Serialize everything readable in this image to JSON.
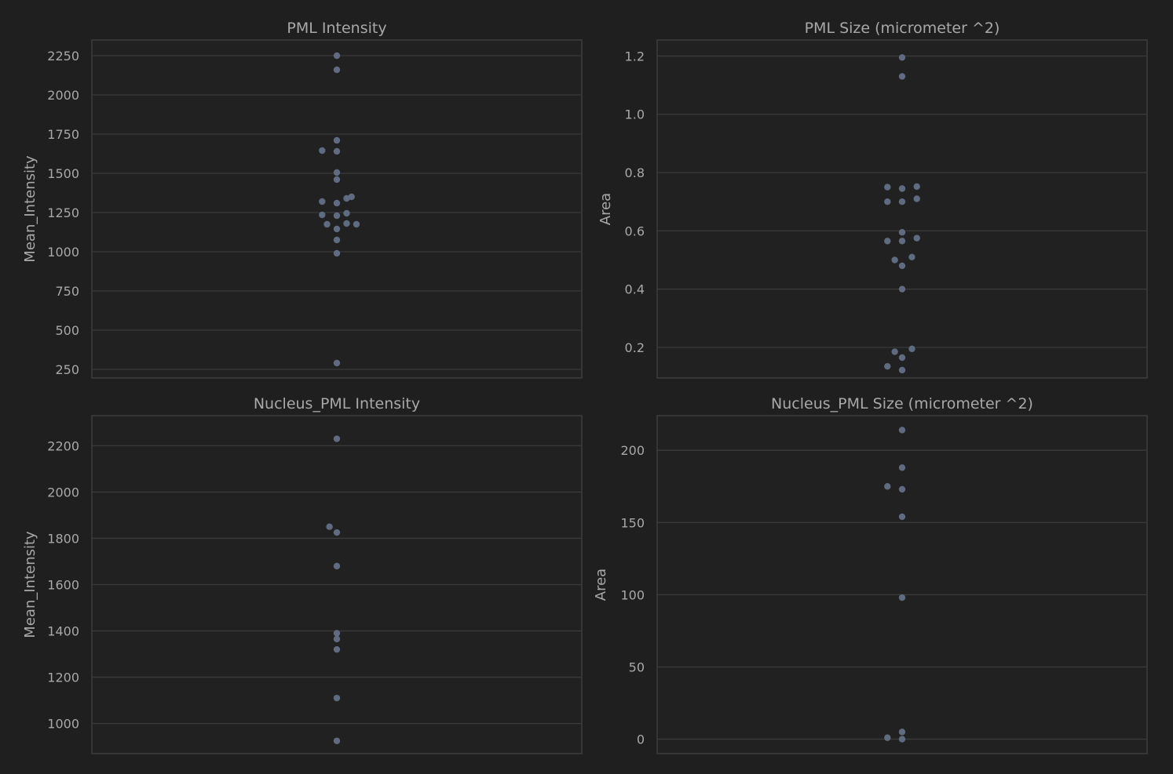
{
  "chart_data": [
    {
      "type": "scatter",
      "title": "PML Intensity",
      "xlabel": "",
      "ylabel": "Mean_Intensity",
      "ylim": [
        195,
        2350
      ],
      "yticks": [
        250,
        500,
        750,
        1000,
        1250,
        1500,
        1750,
        2000,
        2250
      ],
      "ytick_labels": [
        "250",
        "500",
        "750",
        "1000",
        "1250",
        "1500",
        "1750",
        "2000",
        "2250"
      ],
      "grid": true,
      "points": [
        {
          "x": 0.0,
          "y": 2250
        },
        {
          "x": 0.0,
          "y": 2160
        },
        {
          "x": 0.0,
          "y": 1710
        },
        {
          "x": -0.03,
          "y": 1645
        },
        {
          "x": 0.0,
          "y": 1640
        },
        {
          "x": 0.0,
          "y": 1505
        },
        {
          "x": 0.0,
          "y": 1460
        },
        {
          "x": 0.03,
          "y": 1350
        },
        {
          "x": 0.02,
          "y": 1340
        },
        {
          "x": -0.03,
          "y": 1320
        },
        {
          "x": 0.0,
          "y": 1310
        },
        {
          "x": 0.02,
          "y": 1245
        },
        {
          "x": -0.03,
          "y": 1235
        },
        {
          "x": 0.0,
          "y": 1230
        },
        {
          "x": -0.02,
          "y": 1175
        },
        {
          "x": 0.02,
          "y": 1180
        },
        {
          "x": 0.04,
          "y": 1175
        },
        {
          "x": 0.0,
          "y": 1145
        },
        {
          "x": 0.0,
          "y": 1075
        },
        {
          "x": 0.0,
          "y": 990
        },
        {
          "x": 0.0,
          "y": 290
        }
      ]
    },
    {
      "type": "scatter",
      "title": "PML Size (micrometer ^2)",
      "xlabel": "",
      "ylabel": "Area",
      "ylim": [
        0.095,
        1.255
      ],
      "yticks": [
        0.2,
        0.4,
        0.6,
        0.8,
        1.0,
        1.2
      ],
      "ytick_labels": [
        "0.2",
        "0.4",
        "0.6",
        "0.8",
        "1.0",
        "1.2"
      ],
      "grid": true,
      "points": [
        {
          "x": 0.0,
          "y": 1.195
        },
        {
          "x": 0.0,
          "y": 1.13
        },
        {
          "x": -0.03,
          "y": 0.75
        },
        {
          "x": 0.0,
          "y": 0.745
        },
        {
          "x": 0.03,
          "y": 0.752
        },
        {
          "x": -0.03,
          "y": 0.7
        },
        {
          "x": 0.0,
          "y": 0.7
        },
        {
          "x": 0.03,
          "y": 0.71
        },
        {
          "x": 0.0,
          "y": 0.595
        },
        {
          "x": 0.03,
          "y": 0.575
        },
        {
          "x": -0.03,
          "y": 0.565
        },
        {
          "x": 0.0,
          "y": 0.565
        },
        {
          "x": 0.02,
          "y": 0.51
        },
        {
          "x": -0.015,
          "y": 0.5
        },
        {
          "x": 0.0,
          "y": 0.48
        },
        {
          "x": 0.0,
          "y": 0.4
        },
        {
          "x": 0.02,
          "y": 0.195
        },
        {
          "x": -0.015,
          "y": 0.185
        },
        {
          "x": 0.0,
          "y": 0.165
        },
        {
          "x": -0.03,
          "y": 0.135
        },
        {
          "x": 0.0,
          "y": 0.122
        }
      ]
    },
    {
      "type": "scatter",
      "title": "Nucleus_PML Intensity",
      "xlabel": "",
      "ylabel": "Mean_Intensity",
      "ylim": [
        870,
        2330
      ],
      "yticks": [
        1000,
        1200,
        1400,
        1600,
        1800,
        2000,
        2200
      ],
      "ytick_labels": [
        "1000",
        "1200",
        "1400",
        "1600",
        "1800",
        "2000",
        "2200"
      ],
      "grid": true,
      "points": [
        {
          "x": 0.0,
          "y": 2230
        },
        {
          "x": -0.015,
          "y": 1850
        },
        {
          "x": 0.0,
          "y": 1825
        },
        {
          "x": 0.0,
          "y": 1680
        },
        {
          "x": 0.0,
          "y": 1390
        },
        {
          "x": 0.0,
          "y": 1365
        },
        {
          "x": 0.0,
          "y": 1320
        },
        {
          "x": 0.0,
          "y": 1110
        },
        {
          "x": 0.0,
          "y": 925
        }
      ]
    },
    {
      "type": "scatter",
      "title": "Nucleus_PML Size (micrometer ^2)",
      "xlabel": "",
      "ylabel": "Area",
      "ylim": [
        -10,
        224
      ],
      "yticks": [
        0,
        50,
        100,
        150,
        200
      ],
      "ytick_labels": [
        "0",
        "50",
        "100",
        "150",
        "200"
      ],
      "grid": true,
      "points": [
        {
          "x": 0.0,
          "y": 214
        },
        {
          "x": 0.0,
          "y": 188
        },
        {
          "x": -0.03,
          "y": 175
        },
        {
          "x": 0.0,
          "y": 173
        },
        {
          "x": 0.0,
          "y": 154
        },
        {
          "x": 0.0,
          "y": 98
        },
        {
          "x": 0.0,
          "y": 5
        },
        {
          "x": -0.03,
          "y": 1
        },
        {
          "x": 0.0,
          "y": 0
        }
      ]
    }
  ]
}
